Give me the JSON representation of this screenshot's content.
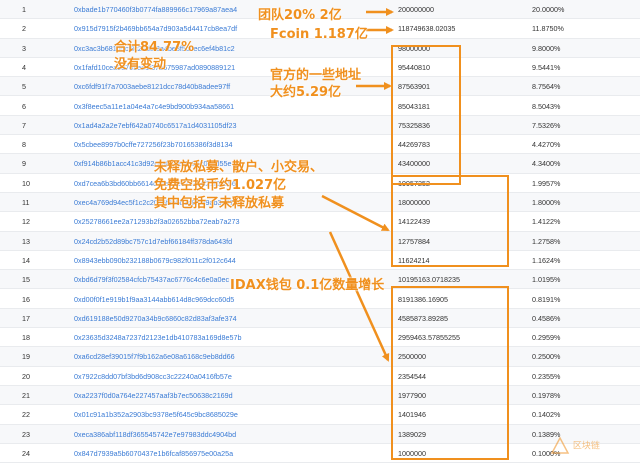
{
  "holders": [
    {
      "rank": "1",
      "address": "0xbade1b770460f3b0774fa889966c17969a87aea4",
      "quantity": "200000000",
      "percentage": "20.0000%"
    },
    {
      "rank": "2",
      "address": "0x915d7915f2b469bb654a7d903a5d4417cb8ea7df",
      "quantity": "118749638.02035",
      "percentage": "11.8750%"
    },
    {
      "rank": "3",
      "address": "0xc3ac3b681d5cf8c26d5f3a4be8f5dcec6ef4b81c2",
      "quantity": "98000000",
      "percentage": "9.8000%"
    },
    {
      "rank": "4",
      "address": "0x1fafd10cea9d705ee1f37b675987ad0890889121",
      "quantity": "95440810",
      "percentage": "9.5441%"
    },
    {
      "rank": "5",
      "address": "0xc6fdf91f7a7003aebe8121dcc78d40b8adee97ff",
      "quantity": "87563901",
      "percentage": "8.7564%"
    },
    {
      "rank": "6",
      "address": "0x3f8eec5a11e1a04e4a7c4e9bd900b934aa58661",
      "quantity": "85043181",
      "percentage": "8.5043%"
    },
    {
      "rank": "7",
      "address": "0x1ad4a2a2e7ebf642a0740c6517a1d4031105df23",
      "quantity": "75325836",
      "percentage": "7.5326%"
    },
    {
      "rank": "8",
      "address": "0x5cbee8997b0cffe727256f23b70165386f3d8134",
      "quantity": "44269783",
      "percentage": "4.4270%"
    },
    {
      "rank": "9",
      "address": "0xf914b86b1acc41c3d92c8a85def4a36c0e5d55e",
      "quantity": "43400000",
      "percentage": "4.3400%"
    },
    {
      "rank": "10",
      "address": "0xd7cea6b3bd60bb6614c7eed1e67c3c4f21f0aa56",
      "quantity": "19957252",
      "percentage": "1.9957%"
    },
    {
      "rank": "11",
      "address": "0xec4a769d94ec5f1c2c20b5f3e5b3c8fb39ab3d87",
      "quantity": "18000000",
      "percentage": "1.8000%"
    },
    {
      "rank": "12",
      "address": "0x25278661ee2a71293b2f3a02652bba72eab7a273",
      "quantity": "14122439",
      "percentage": "1.4122%"
    },
    {
      "rank": "13",
      "address": "0x24cd2b52d89bc757c1d7ebf66184ff378da643fd",
      "quantity": "12757884",
      "percentage": "1.2758%"
    },
    {
      "rank": "14",
      "address": "0x8943ebb090b232188b0679c982f011c2f012c644",
      "quantity": "11624214",
      "percentage": "1.1624%"
    },
    {
      "rank": "15",
      "address": "0xbd6d79f3f02584cfcb75437ac6776c4c6e0a0ec",
      "quantity": "10195163.0718235",
      "percentage": "1.0195%"
    },
    {
      "rank": "16",
      "address": "0xd00f0f1e919b1f9aa3144abb614d8c969dcc60d5",
      "quantity": "8191386.16905",
      "percentage": "0.8191%"
    },
    {
      "rank": "17",
      "address": "0xd619188e50d9270a34b9c6860c82d83af3afe374",
      "quantity": "4585873.89285",
      "percentage": "0.4586%"
    },
    {
      "rank": "18",
      "address": "0x23635d3248a7237d2123e1db410783a169d8e57b",
      "quantity": "2959463.57855255",
      "percentage": "0.2959%"
    },
    {
      "rank": "19",
      "address": "0xa6cd28ef39015f7f9b162a6e08a6168c9eb8dd66",
      "quantity": "2500000",
      "percentage": "0.2500%"
    },
    {
      "rank": "20",
      "address": "0x7922c8dd07bf3bd6d908cc3c22240a0416fb57e",
      "quantity": "2354544",
      "percentage": "0.2355%"
    },
    {
      "rank": "21",
      "address": "0xa2237f0d0a764e227457aaf3b7ec50638c2169d",
      "quantity": "1977900",
      "percentage": "0.1978%"
    },
    {
      "rank": "22",
      "address": "0x01c91a1b352a2903bc9378e5f645c9bc8685029e",
      "quantity": "1401946",
      "percentage": "0.1402%"
    },
    {
      "rank": "23",
      "address": "0xeca386abf118df365545742e7e97983ddc4904bd",
      "quantity": "1389029",
      "percentage": "0.1389%"
    },
    {
      "rank": "24",
      "address": "0x847d7939a5b6070437e1b6fcaf856975e00a25a",
      "quantity": "1000000",
      "percentage": "0.1000%"
    }
  ],
  "annotations": {
    "team": "团队20% 2亿",
    "fcoin": "Fcoin 1.187亿",
    "total_line1": "合计84.77%",
    "total_line2": "没有变动",
    "official_line1": "官方的一些地址",
    "official_line2": "大约5.29亿",
    "unreleased_line1": "未释放私募、散户、小交易、",
    "unreleased_line2": "免费空投币约1.027亿",
    "unreleased_line3": "其中包括了未释放私募",
    "idax": "IDAX钱包 0.1亿数量增长"
  },
  "watermark": "区块链",
  "colors": {
    "annotation": "#f0901e",
    "address_link": "#3a7bd5"
  }
}
